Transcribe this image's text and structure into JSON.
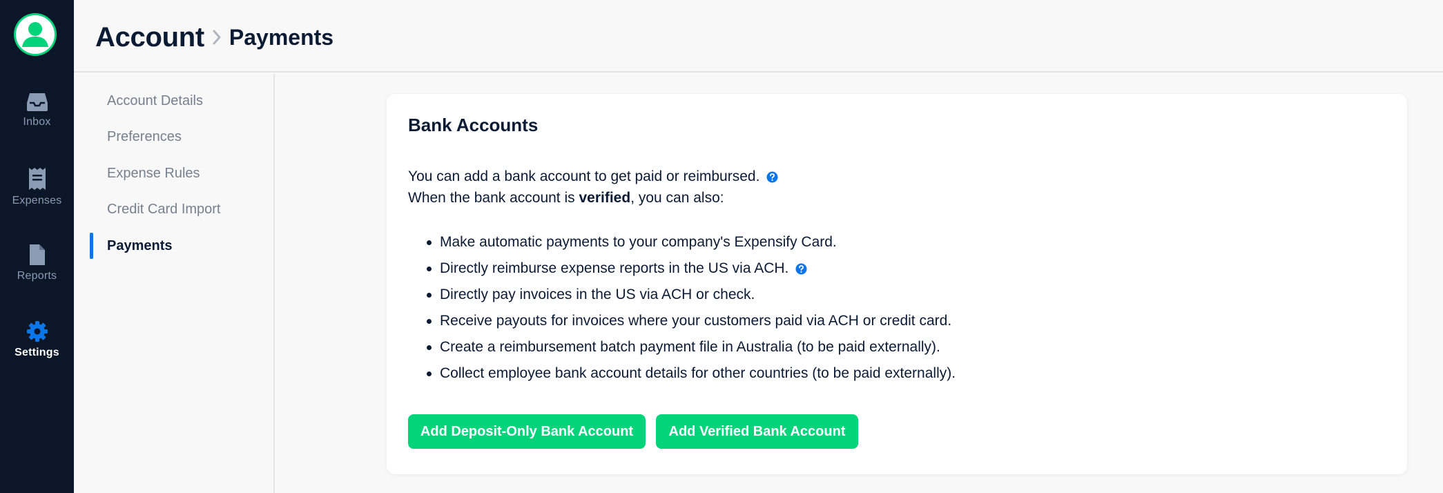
{
  "rail": {
    "items": [
      {
        "label": "Inbox",
        "icon": "inbox-icon"
      },
      {
        "label": "Expenses",
        "icon": "receipt-icon"
      },
      {
        "label": "Reports",
        "icon": "document-icon"
      },
      {
        "label": "Settings",
        "icon": "gear-icon",
        "active": true
      }
    ]
  },
  "header": {
    "root": "Account",
    "current": "Payments"
  },
  "subnav": {
    "items": [
      {
        "label": "Account Details"
      },
      {
        "label": "Preferences"
      },
      {
        "label": "Expense Rules"
      },
      {
        "label": "Credit Card Import"
      },
      {
        "label": "Payments",
        "active": true
      }
    ]
  },
  "card": {
    "title": "Bank Accounts",
    "intro_line1": "You can add a bank account to get paid or reimbursed.",
    "intro_line2_prefix": "When the bank account is ",
    "intro_line2_bold": "verified",
    "intro_line2_suffix": ", you can also:",
    "bullets": [
      "Make automatic payments to your company's Expensify Card.",
      "Directly reimburse expense reports in the US via ACH.",
      "Directly pay invoices in the US via ACH or check.",
      "Receive payouts for invoices where your customers paid via ACH or credit card.",
      "Create a reimbursement batch payment file in Australia (to be paid externally).",
      "Collect employee bank account details for other countries (to be paid externally)."
    ],
    "buttons": {
      "deposit_only": "Add Deposit-Only Bank Account",
      "verified": "Add Verified Bank Account"
    }
  },
  "colors": {
    "rail_bg": "#0b1628",
    "accent_green": "#03d47c",
    "accent_blue": "#0b76ea",
    "text_dark": "#0b1b34",
    "text_muted": "#76808f"
  }
}
